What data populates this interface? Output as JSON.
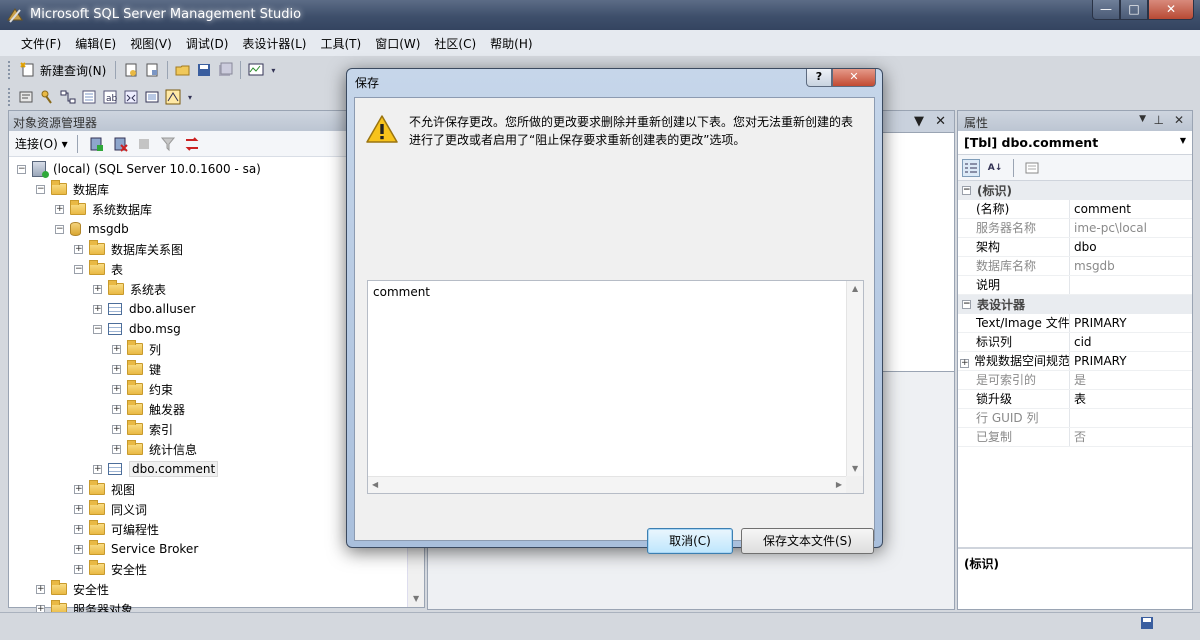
{
  "window": {
    "title": "Microsoft SQL Server Management Studio",
    "controls": {
      "minimize": "—",
      "maximize": "□",
      "close": "✕"
    }
  },
  "menu": [
    "文件(F)",
    "编辑(E)",
    "视图(V)",
    "调试(D)",
    "表设计器(L)",
    "工具(T)",
    "窗口(W)",
    "社区(C)",
    "帮助(H)"
  ],
  "toolbar": {
    "new_query": "新建查询(N)"
  },
  "object_explorer": {
    "title": "对象资源管理器",
    "connect_label": "连接(O)",
    "tree": [
      {
        "label": "(local) (SQL Server 10.0.1600 - sa)",
        "icon": "server",
        "depth": 0,
        "expander": "−"
      },
      {
        "label": "数据库",
        "icon": "folder",
        "depth": 1,
        "expander": "−"
      },
      {
        "label": "系统数据库",
        "icon": "folder",
        "depth": 2,
        "expander": "+"
      },
      {
        "label": "msgdb",
        "icon": "database",
        "depth": 2,
        "expander": "−"
      },
      {
        "label": "数据库关系图",
        "icon": "folder",
        "depth": 3,
        "expander": "+"
      },
      {
        "label": "表",
        "icon": "folder",
        "depth": 3,
        "expander": "−"
      },
      {
        "label": "系统表",
        "icon": "folder",
        "depth": 4,
        "expander": "+"
      },
      {
        "label": "dbo.alluser",
        "icon": "table",
        "depth": 4,
        "expander": "+"
      },
      {
        "label": "dbo.msg",
        "icon": "table",
        "depth": 4,
        "expander": "−"
      },
      {
        "label": "列",
        "icon": "folder",
        "depth": 5,
        "expander": "+"
      },
      {
        "label": "键",
        "icon": "folder",
        "depth": 5,
        "expander": "+"
      },
      {
        "label": "约束",
        "icon": "folder",
        "depth": 5,
        "expander": "+"
      },
      {
        "label": "触发器",
        "icon": "folder",
        "depth": 5,
        "expander": "+"
      },
      {
        "label": "索引",
        "icon": "folder",
        "depth": 5,
        "expander": "+"
      },
      {
        "label": "统计信息",
        "icon": "folder",
        "depth": 5,
        "expander": "+"
      },
      {
        "label": "dbo.comment",
        "icon": "table",
        "depth": 4,
        "expander": "+",
        "selected": true
      },
      {
        "label": "视图",
        "icon": "folder",
        "depth": 3,
        "expander": "+"
      },
      {
        "label": "同义词",
        "icon": "folder",
        "depth": 3,
        "expander": "+"
      },
      {
        "label": "可编程性",
        "icon": "folder",
        "depth": 3,
        "expander": "+"
      },
      {
        "label": "Service Broker",
        "icon": "folder",
        "depth": 3,
        "expander": "+"
      },
      {
        "label": "安全性",
        "icon": "folder",
        "depth": 3,
        "expander": "+"
      },
      {
        "label": "安全性",
        "icon": "folder",
        "depth": 1,
        "expander": "+"
      },
      {
        "label": "服务器对象",
        "icon": "folder",
        "depth": 1,
        "expander": "+"
      }
    ]
  },
  "properties": {
    "title": "属性",
    "object": "[Tbl] dbo.comment",
    "categories": [
      {
        "name": "(标识)",
        "rows": [
          {
            "name": "(名称)",
            "value": "comment",
            "disabled": false
          },
          {
            "name": "服务器名称",
            "value": "ime-pc\\local",
            "disabled": true
          },
          {
            "name": "架构",
            "value": "dbo",
            "disabled": false
          },
          {
            "name": "数据库名称",
            "value": "msgdb",
            "disabled": true
          },
          {
            "name": "说明",
            "value": "",
            "disabled": false
          }
        ]
      },
      {
        "name": "表设计器",
        "rows": [
          {
            "name": "Text/Image 文件",
            "value": "PRIMARY",
            "disabled": false
          },
          {
            "name": "标识列",
            "value": "cid",
            "disabled": false
          },
          {
            "name": "常规数据空间规范",
            "value": "PRIMARY",
            "disabled": false,
            "expander": "+"
          },
          {
            "name": "是可索引的",
            "value": "是",
            "disabled": true
          },
          {
            "name": "锁升级",
            "value": "表",
            "disabled": false
          },
          {
            "name": "行 GUID 列",
            "value": "",
            "disabled": true
          },
          {
            "name": "已复制",
            "value": "否",
            "disabled": true
          }
        ]
      }
    ],
    "description_title": "(标识)"
  },
  "dialog": {
    "title": "保存",
    "help_glyph": "?",
    "close_glyph": "✕",
    "message": "不允许保存更改。您所做的更改要求删除并重新创建以下表。您对无法重新创建的表进行了更改或者启用了“阻止保存要求重新创建表的更改”选项。",
    "details": "comment",
    "cancel_label": "取消(C)",
    "save_text_label": "保存文本文件(S)"
  }
}
